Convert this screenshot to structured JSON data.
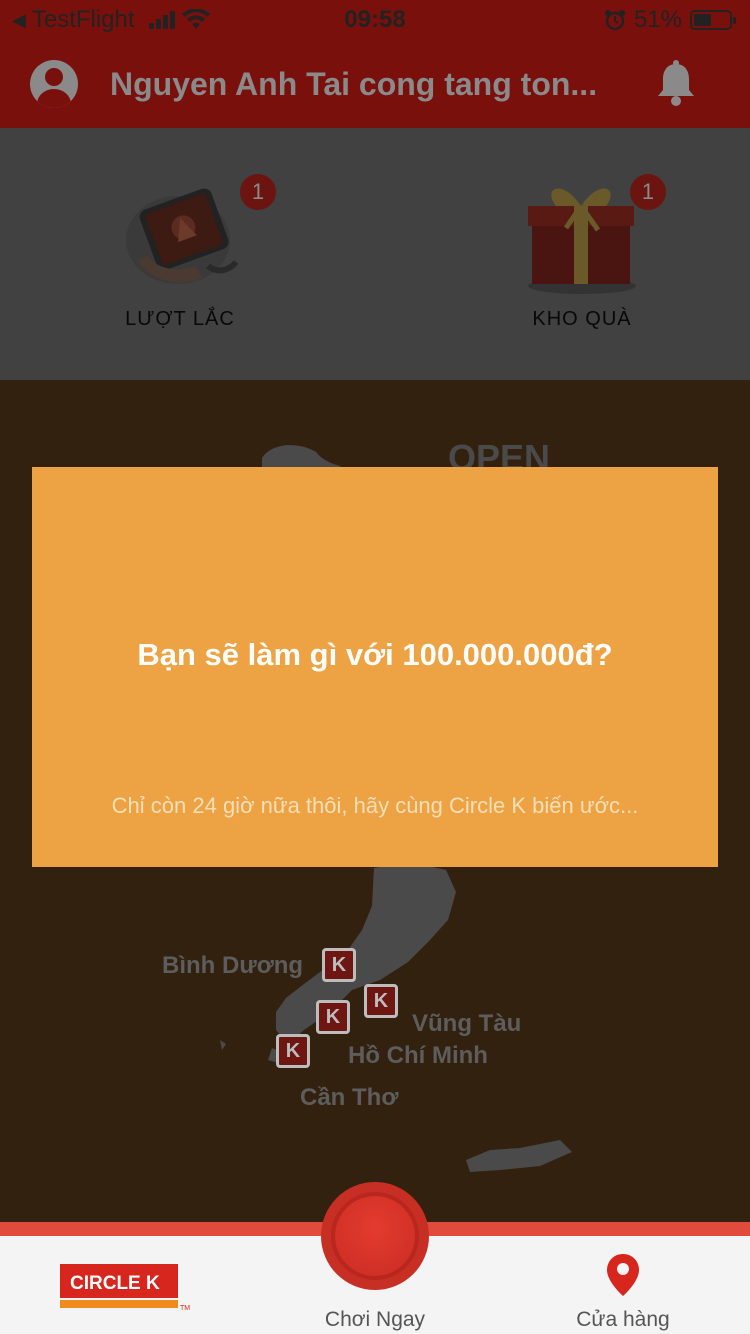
{
  "status_bar": {
    "back_app": "TestFlight",
    "time": "09:58",
    "battery_text": "51%",
    "battery_level": 0.51
  },
  "header": {
    "title": "Nguyen Anh Tai cong tang ton..."
  },
  "summary": {
    "items": [
      {
        "label": "LƯỢT LẮC",
        "badge": "1",
        "icon": "phone-shake-icon"
      },
      {
        "label": "KHO QUÀ",
        "badge": "1",
        "icon": "gift-box-icon"
      }
    ]
  },
  "map": {
    "banner_text": "OPEN",
    "cities": [
      "Bình Dương",
      "Vũng Tàu",
      "Hồ Chí Minh",
      "Cần Thơ"
    ],
    "marker_letter": "K"
  },
  "dialog": {
    "title": "Bạn sẽ làm gì với 100.000.000đ?",
    "subtitle": "Chỉ còn 24 giờ nữa thôi, hãy cùng Circle K biến ước..."
  },
  "tabbar": {
    "logo_text": "CIRCLE K",
    "play_label": "Chơi Ngay",
    "store_label": "Cửa hàng"
  },
  "colors": {
    "header_red": "#7a100c",
    "dialog_orange": "#eda244",
    "accent_red": "#e04b3c"
  }
}
